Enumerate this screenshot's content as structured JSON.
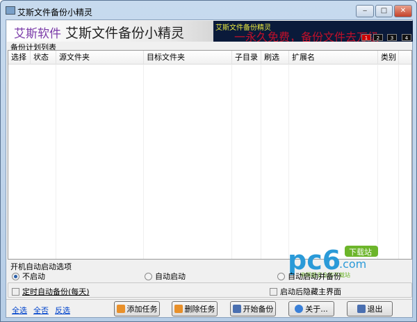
{
  "window": {
    "title": "艾斯文件备份小精灵",
    "minimize": "‒",
    "maximize": "□",
    "close": "✕"
  },
  "banner": {
    "brand": "艾斯软件",
    "app_name": "艾斯文件备份小精灵",
    "ad_line1": "艾斯文件备份精灵",
    "ad_line2": "一永久免费，备份文件去万级",
    "ad_pages": [
      "1",
      "2",
      "3",
      "4"
    ]
  },
  "list": {
    "label": "备份计划列表",
    "columns": [
      "选择",
      "状态",
      "源文件夹",
      "目标文件夹",
      "子目录",
      "刷选",
      "扩展名",
      "类别"
    ],
    "rows": []
  },
  "startup": {
    "label": "开机自动启动选项",
    "options": [
      {
        "label": "不启动",
        "selected": true
      },
      {
        "label": "自动启动",
        "selected": false
      },
      {
        "label": "自动启动并备份",
        "selected": false
      }
    ]
  },
  "checks": {
    "timed_backup": {
      "label": "定时自动备份(每天)",
      "checked": false
    },
    "hide_ui": {
      "label": "启动后隐藏主界面",
      "checked": false
    }
  },
  "links": {
    "select_all": "全选",
    "select_none": "全否",
    "invert": "反选"
  },
  "buttons": {
    "add": "添加任务",
    "delete": "删除任务",
    "start": "开始备份",
    "about": "关于...",
    "exit": "退出"
  },
  "watermark": {
    "text": "pc6",
    "domain": ".com",
    "badge": "下载站",
    "slogan": "中国最安全的下载站"
  }
}
